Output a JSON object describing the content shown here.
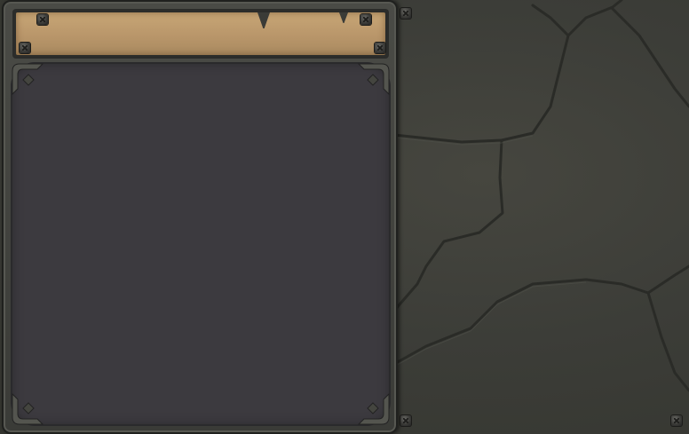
{
  "window": {
    "title": ""
  },
  "theme": {
    "stone": "#3c3d38",
    "frame": "#4a4b46",
    "parchment": "#c7a676",
    "panel": "#3c3a3f"
  },
  "icons": {
    "rivet": "rivet-icon",
    "corner": "corner-ornament-icon"
  }
}
